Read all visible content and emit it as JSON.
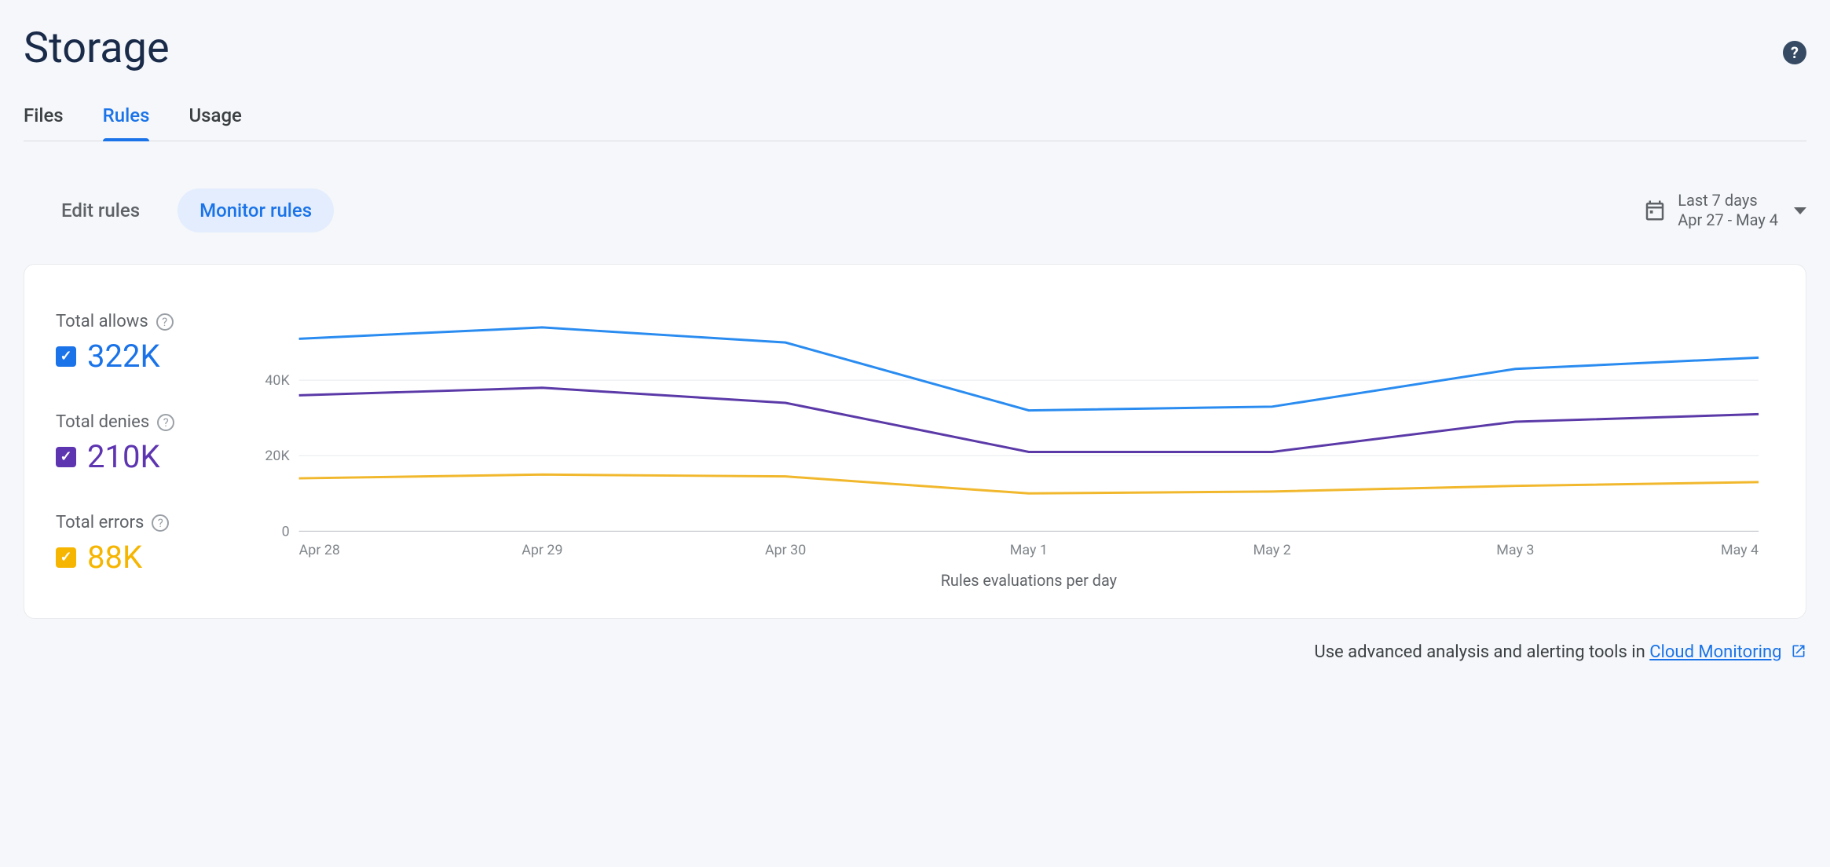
{
  "page_title": "Storage",
  "tabs": {
    "files": "Files",
    "rules": "Rules",
    "usage": "Usage"
  },
  "sub_tabs": {
    "edit": "Edit rules",
    "monitor": "Monitor rules"
  },
  "date_picker": {
    "range_label": "Last 7 days",
    "range_detail": "Apr 27 - May 4"
  },
  "legend": {
    "allows": {
      "label": "Total allows",
      "value": "322K"
    },
    "denies": {
      "label": "Total denies",
      "value": "210K"
    },
    "errors": {
      "label": "Total errors",
      "value": "88K"
    }
  },
  "footer": {
    "text_prefix": "Use advanced analysis and alerting tools in ",
    "link_text": "Cloud Monitoring"
  },
  "chart_data": {
    "type": "line",
    "title": "",
    "xlabel": "Rules evaluations per day",
    "ylabel": "",
    "ylim": [
      0,
      60000
    ],
    "y_ticks": [
      0,
      20000,
      40000
    ],
    "y_tick_labels": [
      "0",
      "20K",
      "40K"
    ],
    "categories": [
      "Apr 28",
      "Apr 29",
      "Apr 30",
      "May 1",
      "May 2",
      "May 3",
      "May 4"
    ],
    "series": [
      {
        "name": "Total allows",
        "color": "#2a8cf0",
        "values": [
          51000,
          54000,
          50000,
          32000,
          33000,
          43000,
          46000
        ]
      },
      {
        "name": "Total denies",
        "color": "#5b3aa8",
        "values": [
          36000,
          38000,
          34000,
          21000,
          21000,
          29000,
          31000
        ]
      },
      {
        "name": "Total errors",
        "color": "#f1b82d",
        "values": [
          14000,
          15000,
          14500,
          10000,
          10500,
          12000,
          13000
        ]
      }
    ]
  }
}
